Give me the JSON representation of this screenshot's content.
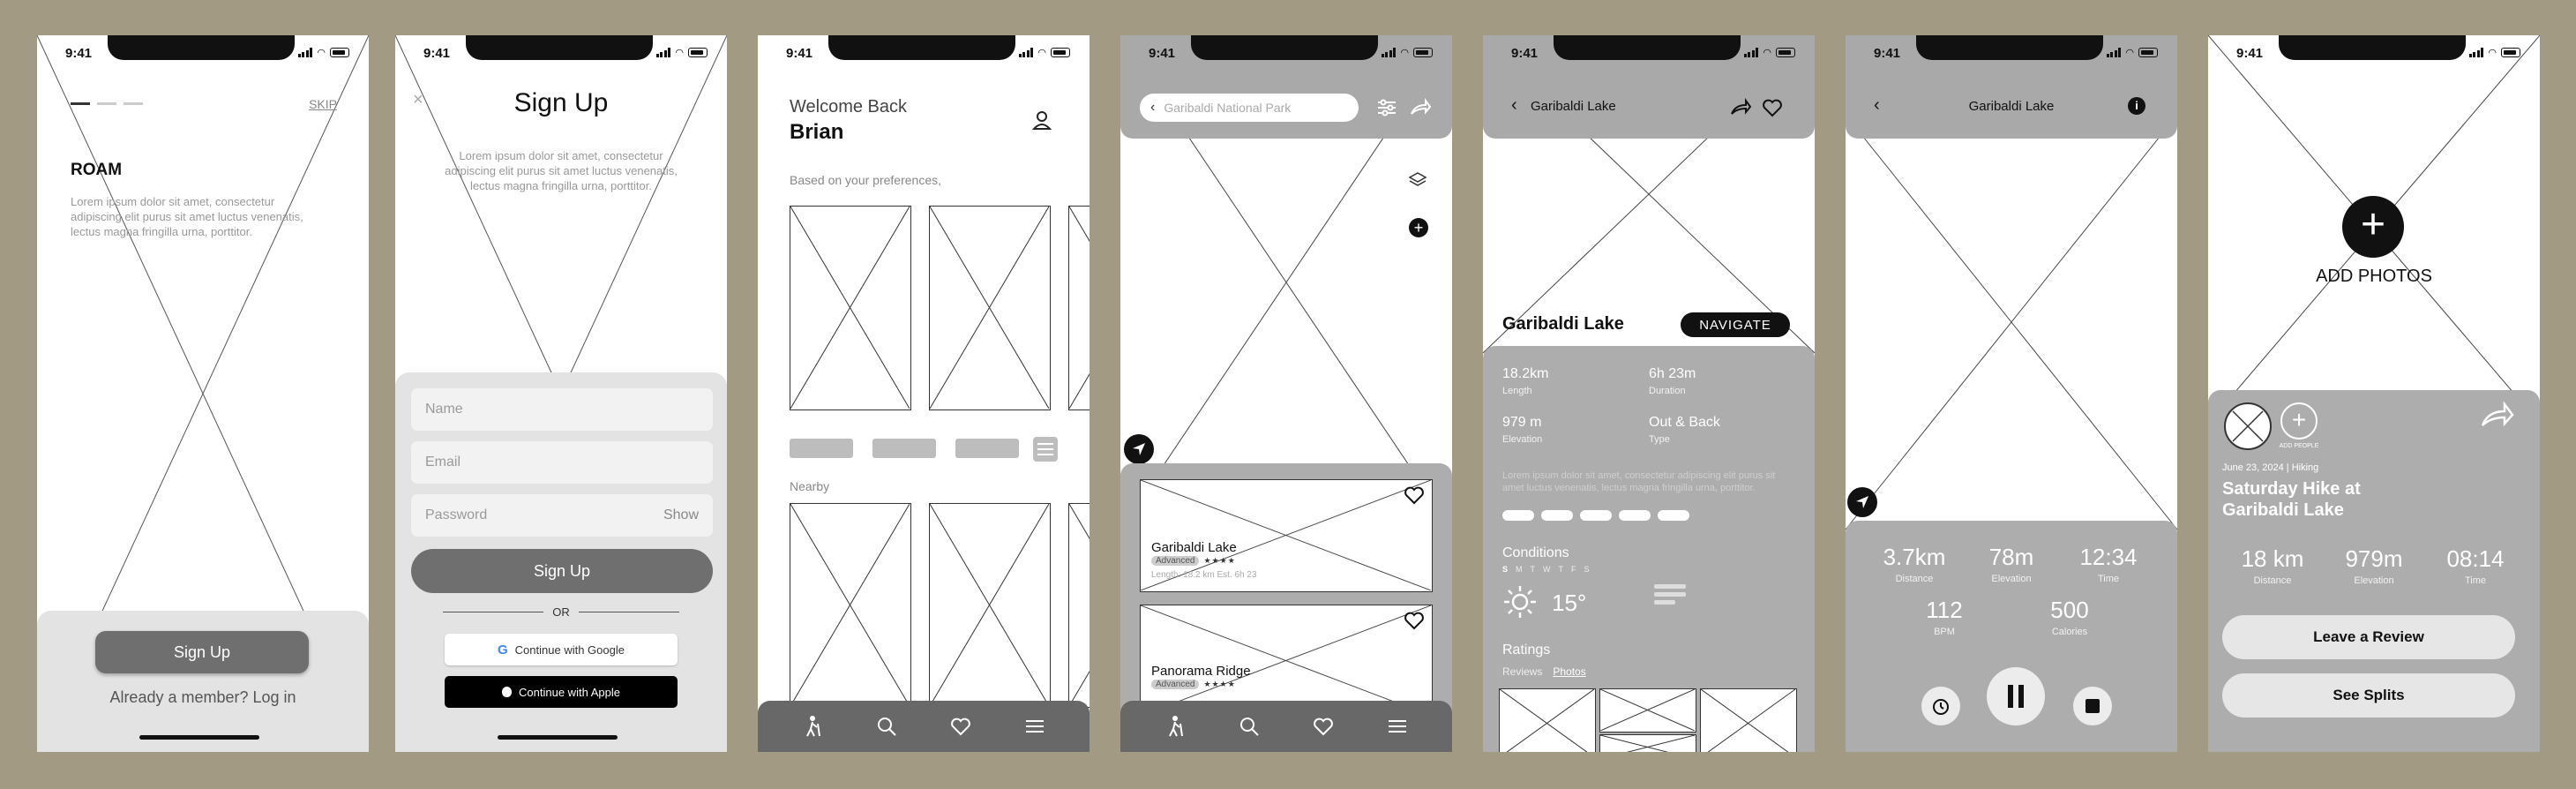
{
  "colors": {
    "background": "#a39a84",
    "sheet_gray": "#adadad",
    "dark_gray": "#686868",
    "light_gray": "#e6e6e6"
  },
  "status": {
    "time": "9:41"
  },
  "s1": {
    "skip": "SKIP",
    "title": "ROAM",
    "body": "Lorem ipsum dolor sit amet, consectetur adipiscing elit purus sit amet luctus venenatis, lectus magna fringilla urna, porttitor.",
    "signup": "Sign Up",
    "login": "Already a member? Log in"
  },
  "s2": {
    "title": "Sign Up",
    "body": "Lorem ipsum dolor sit amet, consectetur adipiscing elit purus sit amet luctus venenatis, lectus magna fringilla urna, porttitor.",
    "name_ph": "Name",
    "email_ph": "Email",
    "password_ph": "Password",
    "show": "Show",
    "signup": "Sign Up",
    "or": "OR",
    "google": "Continue with Google",
    "apple": "Continue with Apple"
  },
  "s3": {
    "welcome": "Welcome Back",
    "name": "Brian",
    "pref": "Based on your preferences,",
    "nearby": "Nearby"
  },
  "s4": {
    "search_value": "Garibaldi National Park",
    "card1": {
      "title": "Garibaldi Lake",
      "badge": "Advanced",
      "meta": "Length: 18.2 km Est. 6h 23"
    },
    "card2": {
      "title": "Panorama Ridge",
      "badge": "Advanced"
    }
  },
  "s5": {
    "header": "Garibaldi Lake",
    "title": "Garibaldi Lake",
    "navigate": "NAVIGATE",
    "stats": [
      {
        "value": "18.2km",
        "label": "Length"
      },
      {
        "value": "6h 23m",
        "label": "Duration"
      },
      {
        "value": "979 m",
        "label": "Elevation"
      },
      {
        "value": "Out & Back",
        "label": "Type"
      }
    ],
    "lorem": "Lorem ipsum dolor sit amet, consectetur adipiscing elit purus sit amet luctus venenatis, lectus magna fringilla urna, porttitor.",
    "conditions": "Conditions",
    "days": [
      "S",
      "M",
      "T",
      "W",
      "T",
      "F",
      "S"
    ],
    "temp": "15°",
    "ratings": "Ratings",
    "reviews_tab": "Reviews",
    "photos_tab": "Photos"
  },
  "s6": {
    "header": "Garibaldi Lake",
    "stats_row1": [
      {
        "value": "3.7km",
        "label": "Distance"
      },
      {
        "value": "78m",
        "label": "Elevation"
      },
      {
        "value": "12:34",
        "label": "Time"
      }
    ],
    "stats_row2": [
      {
        "value": "112",
        "label": "BPM"
      },
      {
        "value": "500",
        "label": "Calories"
      }
    ]
  },
  "s7": {
    "add_photos": "ADD PHOTOS",
    "add_people": "ADD PEOPLE",
    "date": "June 23, 2024 | Hiking",
    "title": "Saturday Hike at Garibaldi Lake",
    "stats": [
      {
        "value": "18 km",
        "label": "Distance"
      },
      {
        "value": "979m",
        "label": "Elevation"
      },
      {
        "value": "08:14",
        "label": "Time"
      }
    ],
    "review": "Leave a Review",
    "splits": "See Splits"
  }
}
